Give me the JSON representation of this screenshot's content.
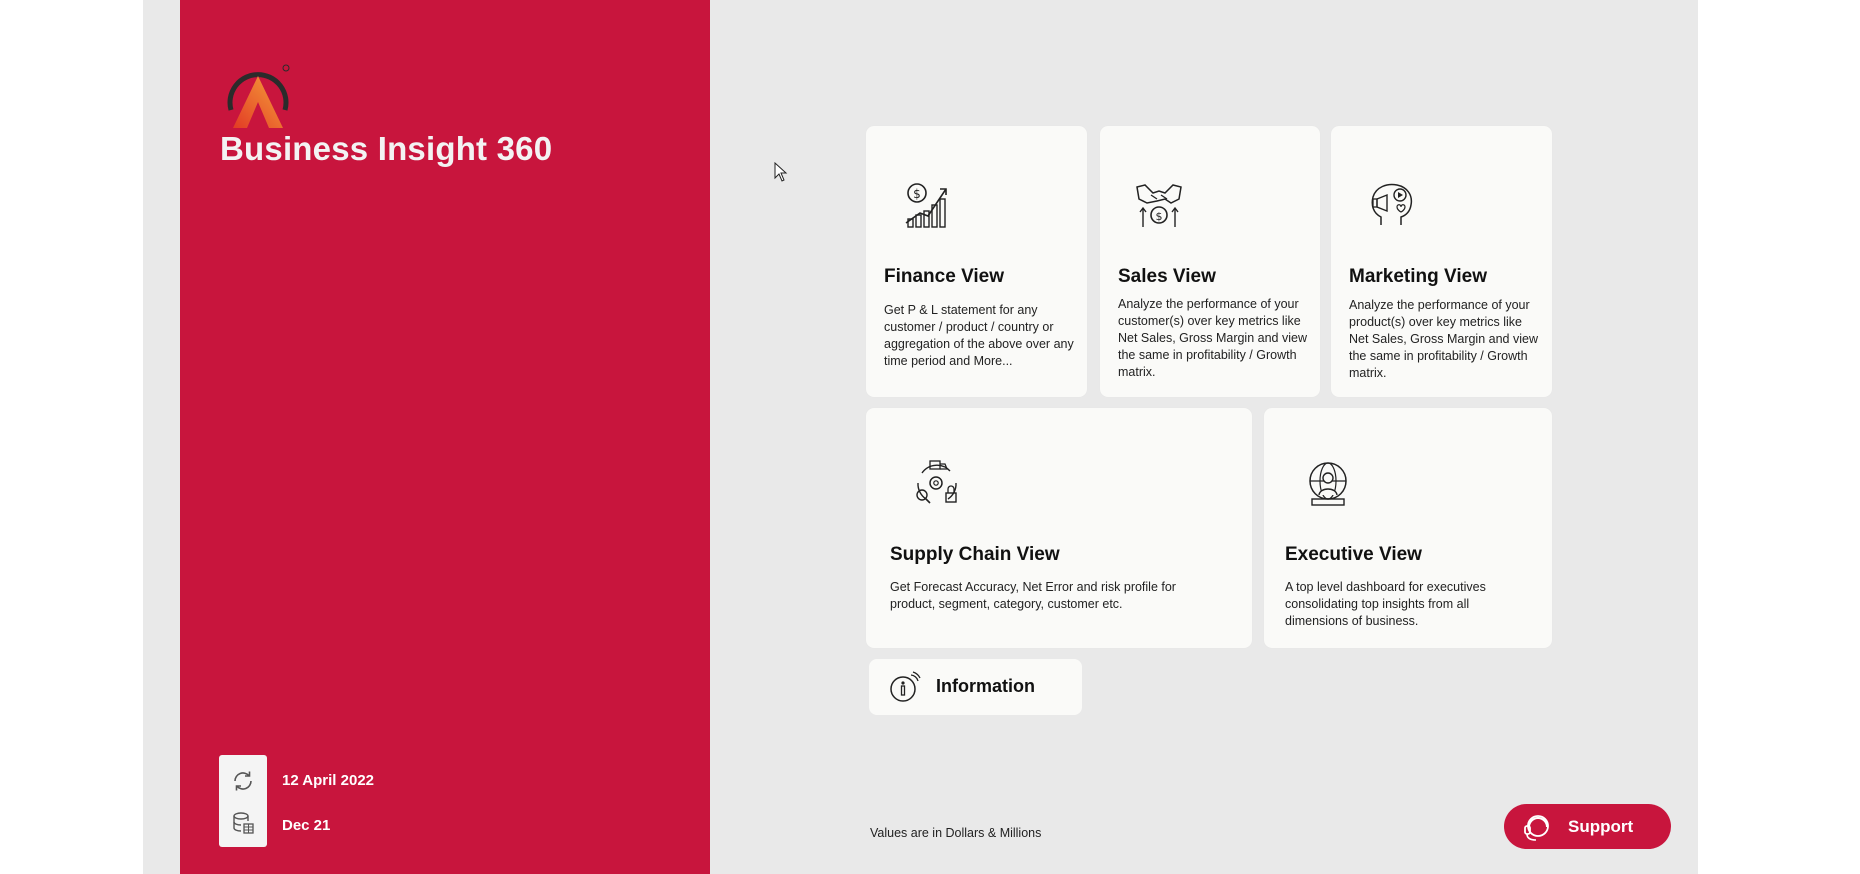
{
  "app": {
    "title": "Business Insight 360",
    "logo_icon": "brand-logo-a"
  },
  "colors": {
    "brand_red": "#c8153d",
    "background": "#e9e9e9",
    "card_bg": "#fafaf8"
  },
  "status": {
    "refresh_icon": "refresh-icon",
    "refresh_date": "12 April 2022",
    "data_icon": "database-icon",
    "data_period": "Dec 21"
  },
  "cards": {
    "finance": {
      "icon": "finance-growth-icon",
      "title": "Finance View",
      "description": "Get P & L statement for any customer / product / country or aggregation of the above over any time period and More..."
    },
    "sales": {
      "icon": "handshake-dollar-icon",
      "title": "Sales View",
      "description": "Analyze the performance of your customer(s) over key metrics like Net Sales, Gross Margin and view the same in profitability / Growth matrix."
    },
    "marketing": {
      "icon": "megaphone-head-icon",
      "title": "Marketing View",
      "description": "Analyze the performance of your product(s) over key metrics like Net Sales, Gross Margin and view the same in profitability / Growth matrix."
    },
    "supply_chain": {
      "icon": "supply-chain-cycle-icon",
      "title": "Supply Chain View",
      "description": "Get Forecast Accuracy, Net Error and risk profile for product, segment, category, customer etc."
    },
    "executive": {
      "icon": "executive-globe-icon",
      "title": "Executive View",
      "description": "A top level dashboard for executives consolidating top insights from all dimensions of business."
    }
  },
  "information": {
    "icon": "information-icon",
    "label": "Information"
  },
  "footer": {
    "note": "Values are in Dollars & Millions"
  },
  "support": {
    "icon": "headset-icon",
    "label": "Support"
  }
}
